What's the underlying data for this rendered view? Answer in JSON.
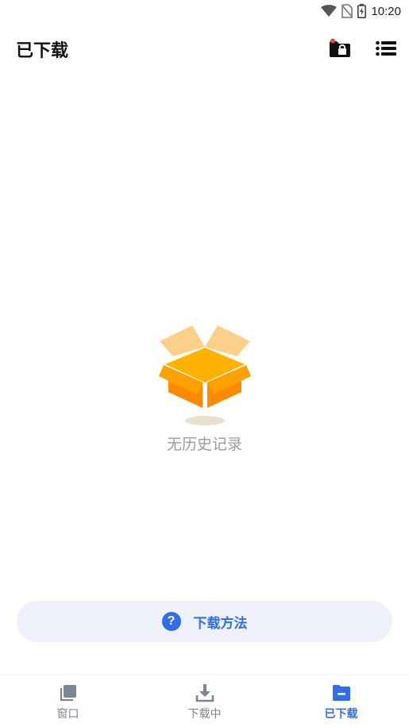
{
  "status": {
    "time": "10:20"
  },
  "header": {
    "title": "已下载"
  },
  "empty": {
    "text": "无历史记录"
  },
  "help": {
    "label": "下载方法",
    "icon_text": "?"
  },
  "nav": {
    "items": [
      {
        "label": "窗口",
        "icon": "window-icon"
      },
      {
        "label": "下载中",
        "icon": "download-icon"
      },
      {
        "label": "已下载",
        "icon": "folder-icon",
        "active": true
      }
    ]
  },
  "colors": {
    "accent": "#2f6ee6",
    "box_orange": "#ff8a00",
    "box_light": "#fdd08a"
  }
}
